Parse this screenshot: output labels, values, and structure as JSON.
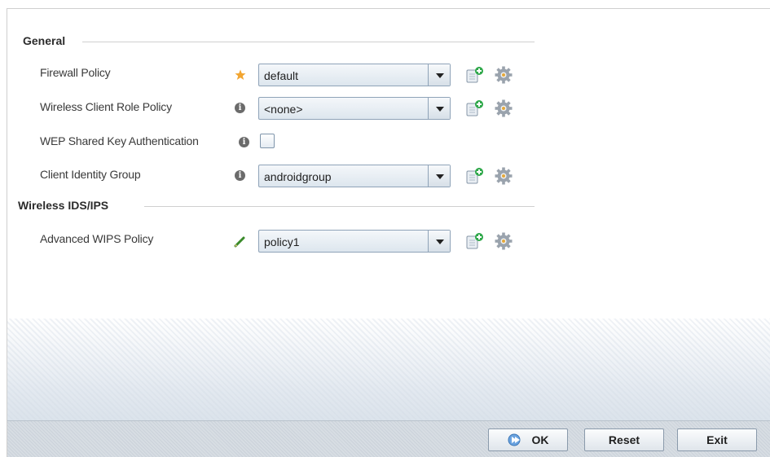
{
  "sections": {
    "general": "General",
    "wireless": "Wireless IDS/IPS"
  },
  "fields": {
    "firewall": {
      "label": "Firewall Policy",
      "value": "default",
      "indicator": "required-star-icon"
    },
    "client_role": {
      "label": "Wireless Client Role Policy",
      "value": "<none>",
      "indicator": "info-icon"
    },
    "wep": {
      "label": "WEP Shared Key Authentication",
      "checked": false,
      "indicator": "info-icon"
    },
    "identity_group": {
      "label": "Client Identity Group",
      "value": "androidgroup",
      "indicator": "info-icon"
    },
    "wips": {
      "label": "Advanced WIPS Policy",
      "value": "policy1",
      "indicator": "edited-pencil-icon"
    }
  },
  "info_glyph": "i",
  "footer": {
    "ok": "OK",
    "reset": "Reset",
    "exit": "Exit"
  },
  "colors": {
    "accent_star": "#f2a531",
    "add_icon_green": "#2fa84a",
    "pencil_green": "#3a8a2a"
  }
}
